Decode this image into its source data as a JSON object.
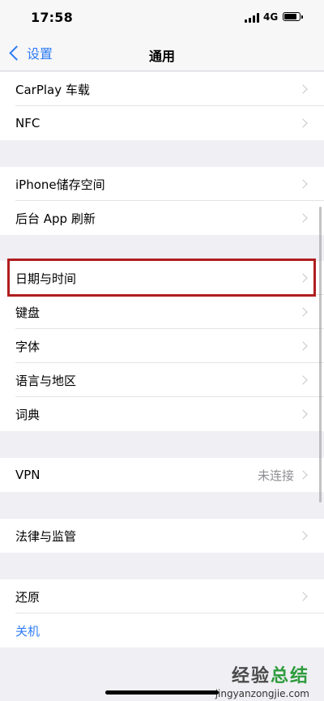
{
  "status_bar": {
    "time": "17:58",
    "network": "4G"
  },
  "nav": {
    "back_label": "设置",
    "title": "通用"
  },
  "rows": [
    {
      "label": "CarPlay 车载"
    },
    {
      "label": "NFC"
    },
    {
      "label": "iPhone储存空间"
    },
    {
      "label": "后台 App 刷新"
    },
    {
      "label": "日期与时间"
    },
    {
      "label": "键盘"
    },
    {
      "label": "字体"
    },
    {
      "label": "语言与地区"
    },
    {
      "label": "词典"
    },
    {
      "label": "VPN",
      "detail": "未连接"
    },
    {
      "label": "法律与监管"
    },
    {
      "label": "还原"
    },
    {
      "label": "关机"
    }
  ],
  "watermark": {
    "main_part1": "经验",
    "main_part2": "总结",
    "sub": "jingyanzongjie.com"
  },
  "colors": {
    "accent": "#2f7cf6",
    "highlight": "#b01e1e",
    "background": "#efeff4"
  }
}
